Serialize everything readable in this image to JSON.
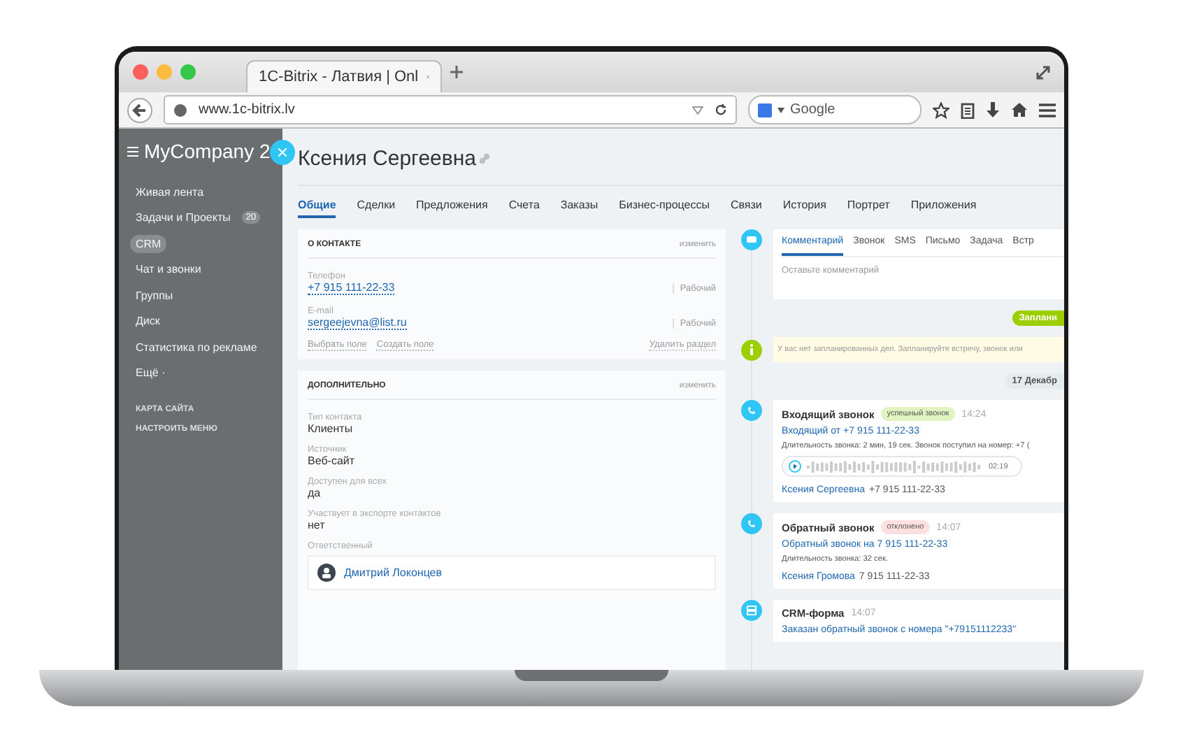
{
  "browser": {
    "tab_title": "1C-Bitrix - Латвия | Onl",
    "url": "www.1c-bitrix.lv",
    "search_placeholder": "Google"
  },
  "sidebar": {
    "logo": "MyCompany 2",
    "items": [
      {
        "label": "Живая лента",
        "selected": false
      },
      {
        "label": "Задачи и Проекты",
        "counter": "20",
        "selected": false
      },
      {
        "label": "CRM",
        "selected": true
      },
      {
        "label": "Чат и звонки",
        "selected": false
      },
      {
        "label": "Группы",
        "selected": false
      },
      {
        "label": "Диск",
        "selected": false
      },
      {
        "label": "Статистика по рекламе",
        "selected": false
      },
      {
        "label": "Ещё ·",
        "selected": false
      }
    ],
    "links": [
      "КАРТА САЙТА",
      "НАСТРОИТЬ МЕНЮ"
    ]
  },
  "contact": {
    "name": "Ксения Сергеевна",
    "tabs": [
      {
        "label": "Общие",
        "selected": true
      },
      {
        "label": "Сделки",
        "selected": false
      },
      {
        "label": "Предложения",
        "selected": false
      },
      {
        "label": "Счета",
        "selected": false
      },
      {
        "label": "Заказы",
        "selected": false
      },
      {
        "label": "Бизнес-процессы",
        "selected": false
      },
      {
        "label": "Связи",
        "selected": false
      },
      {
        "label": "История",
        "selected": false
      },
      {
        "label": "Портрет",
        "selected": false
      },
      {
        "label": "Приложения",
        "selected": false
      }
    ]
  },
  "about": {
    "title": "О КОНТАКТЕ",
    "edit": "изменить",
    "fields": [
      {
        "label": "Телефон",
        "value": "+7 915 111-22-33",
        "type": "Рабочий"
      },
      {
        "label": "E-mail",
        "value": "sergeejevna@list.ru",
        "type": "Рабочий"
      }
    ],
    "actions": [
      "Выбрать поле",
      "Создать поле"
    ],
    "delete": "Удалить раздел"
  },
  "extra": {
    "title": "ДОПОЛНИТЕЛЬНО",
    "edit": "изменить",
    "fields": [
      {
        "label": "Тип контакта",
        "value": "Клиенты"
      },
      {
        "label": "Источник",
        "value": "Веб-сайт"
      },
      {
        "label": "Доступен для всех",
        "value": "да"
      },
      {
        "label": "Участвует в экспорте контактов",
        "value": "нет"
      }
    ],
    "responsible_label": "Ответственный",
    "responsible": "Дмитрий Локонцев"
  },
  "timeline": {
    "tabs": [
      {
        "label": "Комментарий",
        "selected": true
      },
      {
        "label": "Звонок",
        "selected": false
      },
      {
        "label": "SMS",
        "selected": false
      },
      {
        "label": "Письмо",
        "selected": false
      },
      {
        "label": "Задача",
        "selected": false
      },
      {
        "label": "Встр",
        "selected": false
      }
    ],
    "comment_placeholder": "Оставьте комментарий",
    "planned_badge": "Заплани",
    "planned_note": "У вас нет запланированных дел. Запланируйте встречу, звонок или",
    "date": "17 Декабр",
    "events": [
      {
        "kind": "call",
        "title": "Входящий звонок",
        "tag": "успешный звонок",
        "color": "#dff4c0",
        "time": "14:24",
        "link": "Входящий от +7 915 111-22-33",
        "info": "Длительность звонка: 2 мин, 19 сек. Звонок поступил на номер: +7 (",
        "duration": "02:19",
        "person": "Ксения Сергеевна",
        "phone": "+7 915 111-22-33"
      },
      {
        "kind": "call",
        "title": "Обратный звонок",
        "tag": "отклонено",
        "color": "#ffe0e0",
        "time": "14:07",
        "link": "Обратный звонок на 7 915 111-22-33",
        "info": "Длительность звонка: 32 сек.",
        "person": "Ксения Громова",
        "phone": "7 915 111-22-33"
      },
      {
        "kind": "form",
        "title": "CRM-форма",
        "time": "14:07",
        "link": "Заказан обратный звонок с номера \"+79151112233\""
      }
    ]
  }
}
